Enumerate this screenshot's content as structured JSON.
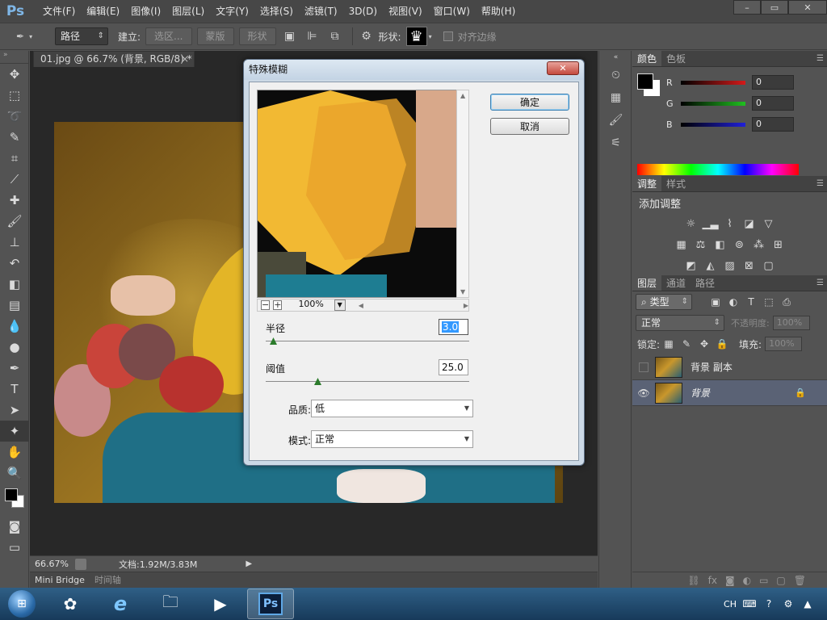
{
  "app": {
    "logo": "Ps",
    "menu": [
      "文件(F)",
      "编辑(E)",
      "图像(I)",
      "图层(L)",
      "文字(Y)",
      "选择(S)",
      "滤镜(T)",
      "3D(D)",
      "视图(V)",
      "窗口(W)",
      "帮助(H)"
    ],
    "window_controls": {
      "minimize": "–",
      "restore": "▭",
      "close": "✕"
    }
  },
  "options_bar": {
    "mode_select": "路径",
    "make_label": "建立:",
    "selection_btn": "选区...",
    "mask_btn": "蒙版",
    "shape_btn": "形状",
    "shape_label": "形状:",
    "align_edges_label": "对齐边缘"
  },
  "document": {
    "tab_title": "01.jpg @ 66.7% (背景, RGB/8) *",
    "tab_close": "×",
    "zoom": "66.67%",
    "doc_size": "文档:1.92M/3.83M",
    "bottom_tabs": [
      "Mini Bridge",
      "时间轴"
    ]
  },
  "color_panel": {
    "tabs": [
      "颜色",
      "色板"
    ],
    "channels": [
      {
        "label": "R",
        "value": "0",
        "color": "#d41a1a"
      },
      {
        "label": "G",
        "value": "0",
        "color": "#20c020"
      },
      {
        "label": "B",
        "value": "0",
        "color": "#2020d8"
      }
    ]
  },
  "adjustments_panel": {
    "tabs": [
      "调整",
      "样式"
    ],
    "title": "添加调整"
  },
  "layers_panel": {
    "tabs": [
      "图层",
      "通道",
      "路径"
    ],
    "filter_select": "类型",
    "blend_mode": "正常",
    "opacity_label": "不透明度:",
    "opacity_value": "100%",
    "lock_label": "锁定:",
    "fill_label": "填充:",
    "fill_value": "100%",
    "layers": [
      {
        "name": "背景 副本",
        "visible": false,
        "selected": false
      },
      {
        "name": "背景",
        "visible": true,
        "selected": true,
        "locked": true
      }
    ]
  },
  "dialog": {
    "title": "特殊模糊",
    "close": "✕",
    "ok": "确定",
    "cancel": "取消",
    "preview_zoom": "100%",
    "radius_label": "半径",
    "radius_value": "3.0",
    "threshold_label": "阈值",
    "threshold_value": "25.0",
    "quality_label": "品质:",
    "quality_value": "低",
    "mode_label": "模式:",
    "mode_value": "正常"
  },
  "taskbar": {
    "tray_lang": "CH"
  }
}
